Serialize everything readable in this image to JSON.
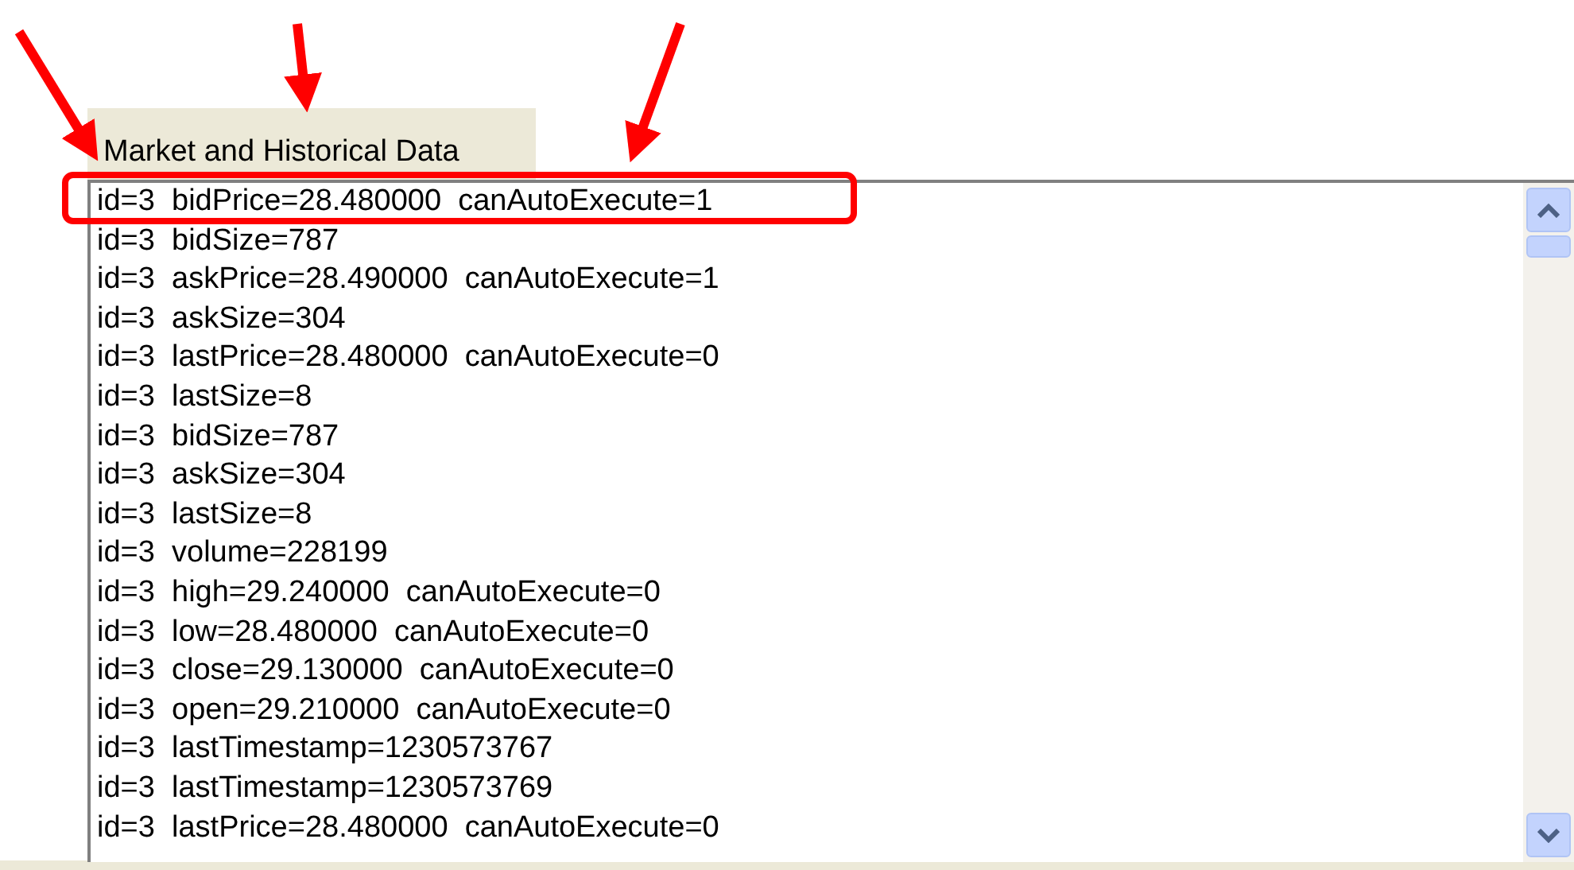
{
  "tab": {
    "label": "Market and Historical Data",
    "selected": true
  },
  "log_lines": [
    "id=3  bidPrice=28.480000  canAutoExecute=1",
    "id=3  bidSize=787",
    "id=3  askPrice=28.490000  canAutoExecute=1",
    "id=3  askSize=304",
    "id=3  lastPrice=28.480000  canAutoExecute=0",
    "id=3  lastSize=8",
    "id=3  bidSize=787",
    "id=3  askSize=304",
    "id=3  lastSize=8",
    "id=3  volume=228199",
    "id=3  high=29.240000  canAutoExecute=0",
    "id=3  low=28.480000  canAutoExecute=0",
    "id=3  close=29.130000  canAutoExecute=0",
    "id=3  open=29.210000  canAutoExecute=0",
    "id=3  lastTimestamp=1230573767",
    "id=3  lastTimestamp=1230573769",
    "id=3  lastPrice=28.480000  canAutoExecute=0"
  ]
}
